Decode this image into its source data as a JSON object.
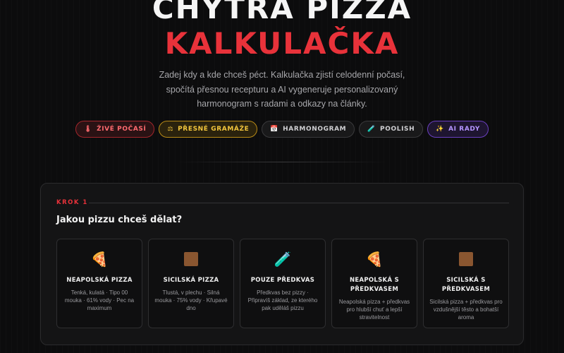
{
  "hero": {
    "title_line1": "CHYTRÁ PIZZA",
    "title_line2": "KALKULAČKA",
    "subtitle": "Zadej kdy a kde chceš péct. Kalkulačka zjistí celodenní počasí, spočítá přesnou recepturu a AI vygeneruje personalizovaný harmonogram s radami a odkazy na články."
  },
  "chips": [
    {
      "icon": "🌡",
      "icon_name": "thermometer-icon",
      "label": "ŽIVÉ POČASÍ",
      "style": "red"
    },
    {
      "icon": "⚖",
      "icon_name": "scale-icon",
      "label": "PŘESNÉ GRAMÁŽE",
      "style": "yellow"
    },
    {
      "icon": "📅",
      "icon_name": "calendar-icon",
      "label": "HARMONOGRAM",
      "style": "default"
    },
    {
      "icon": "🧪",
      "icon_name": "test-tube-icon",
      "label": "POOLISH",
      "style": "default"
    },
    {
      "icon": "✨",
      "icon_name": "sparkles-icon",
      "label": "AI RADY",
      "style": "purple"
    }
  ],
  "step": {
    "label": "KROK 1",
    "question": "Jakou pizzu chceš dělat?"
  },
  "cards": [
    {
      "icon": "🍕",
      "icon_name": "pizza-slice-icon",
      "title": "NEAPOLSKÁ PIZZA",
      "desc": "Tenká, kulatá · Tipo 00 mouka · 61% vody · Pec na maximum"
    },
    {
      "icon": "",
      "icon_name": "square-pan-icon",
      "title": "SICILSKÁ PIZZA",
      "desc": "Tlustá, v plechu · Silná mouka · 75% vody · Křupavé dno"
    },
    {
      "icon": "🧪",
      "icon_name": "test-tube-icon",
      "title": "POUZE PŘEDKVAS",
      "desc": "Předkvas bez pizzy · Připravíš základ, ze kterého pak uděláš pizzu"
    },
    {
      "icon": "🍕",
      "icon_name": "pizza-slice-icon",
      "title": "NEAPOLSKÁ S PŘEDKVASEM",
      "desc": "Neapolská pizza + předkvas pro hlubší chuť a lepší stravitelnost"
    },
    {
      "icon": "",
      "icon_name": "square-pan-icon",
      "title": "SICILSKÁ S PŘEDKVASEM",
      "desc": "Sicilská pizza + předkvas pro vzdušnější těsto a bohatší aroma"
    }
  ],
  "colors": {
    "accent_red": "#e8323a",
    "accent_yellow": "#f2c53d",
    "accent_purple": "#b595ff",
    "background": "#0c0c0d"
  }
}
